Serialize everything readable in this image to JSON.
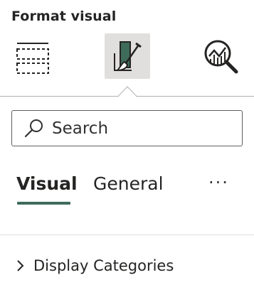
{
  "pane": {
    "title": "Format visual"
  },
  "toolbar": {
    "buttons": [
      {
        "icon": "fields-build-icon",
        "active": false
      },
      {
        "icon": "format-paintbrush-icon",
        "active": true
      },
      {
        "icon": "analytics-magnifier-icon",
        "active": false
      }
    ]
  },
  "search": {
    "placeholder": "Search"
  },
  "tabs": {
    "items": [
      {
        "label": "Visual",
        "active": true
      },
      {
        "label": "General",
        "active": false
      }
    ],
    "more_label": "···"
  },
  "sections": [
    {
      "label": "Display Categories",
      "expanded": false
    }
  ],
  "colors": {
    "accent": "#3f6b5b",
    "active_button_bg": "#e1dfdd"
  }
}
